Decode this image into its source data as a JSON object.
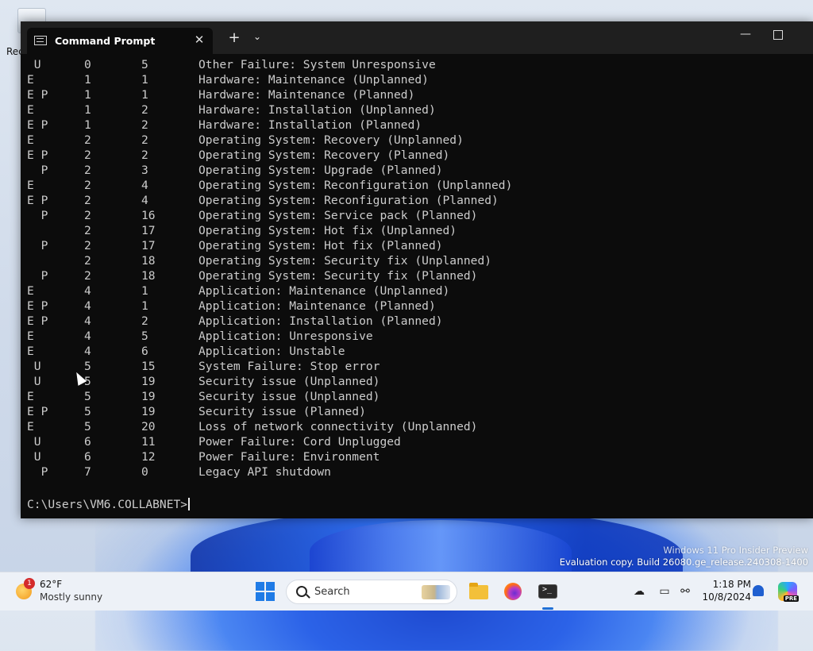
{
  "desktop": {
    "icon_label": "Rec",
    "watermark_line1": "Windows 11 Pro Insider Preview",
    "watermark_line2": "Evaluation copy. Build 26080.ge_release.240308-1400"
  },
  "window": {
    "tab_title": "Command Prompt",
    "tab_close_glyph": "✕",
    "new_tab_glyph": "+",
    "dropdown_glyph": "⌄",
    "minimize_glyph": "—"
  },
  "console": {
    "rows": [
      [
        " U",
        "0",
        "5",
        "Other Failure: System Unresponsive"
      ],
      [
        "E",
        "1",
        "1",
        "Hardware: Maintenance (Unplanned)"
      ],
      [
        "E P",
        "1",
        "1",
        "Hardware: Maintenance (Planned)"
      ],
      [
        "E",
        "1",
        "2",
        "Hardware: Installation (Unplanned)"
      ],
      [
        "E P",
        "1",
        "2",
        "Hardware: Installation (Planned)"
      ],
      [
        "E",
        "2",
        "2",
        "Operating System: Recovery (Unplanned)"
      ],
      [
        "E P",
        "2",
        "2",
        "Operating System: Recovery (Planned)"
      ],
      [
        "  P",
        "2",
        "3",
        "Operating System: Upgrade (Planned)"
      ],
      [
        "E",
        "2",
        "4",
        "Operating System: Reconfiguration (Unplanned)"
      ],
      [
        "E P",
        "2",
        "4",
        "Operating System: Reconfiguration (Planned)"
      ],
      [
        "  P",
        "2",
        "16",
        "Operating System: Service pack (Planned)"
      ],
      [
        "",
        "2",
        "17",
        "Operating System: Hot fix (Unplanned)"
      ],
      [
        "  P",
        "2",
        "17",
        "Operating System: Hot fix (Planned)"
      ],
      [
        "",
        "2",
        "18",
        "Operating System: Security fix (Unplanned)"
      ],
      [
        "  P",
        "2",
        "18",
        "Operating System: Security fix (Planned)"
      ],
      [
        "E",
        "4",
        "1",
        "Application: Maintenance (Unplanned)"
      ],
      [
        "E P",
        "4",
        "1",
        "Application: Maintenance (Planned)"
      ],
      [
        "E P",
        "4",
        "2",
        "Application: Installation (Planned)"
      ],
      [
        "E",
        "4",
        "5",
        "Application: Unresponsive"
      ],
      [
        "E",
        "4",
        "6",
        "Application: Unstable"
      ],
      [
        " U",
        "5",
        "15",
        "System Failure: Stop error"
      ],
      [
        " U",
        "5",
        "19",
        "Security issue (Unplanned)"
      ],
      [
        "E",
        "5",
        "19",
        "Security issue (Unplanned)"
      ],
      [
        "E P",
        "5",
        "19",
        "Security issue (Planned)"
      ],
      [
        "E",
        "5",
        "20",
        "Loss of network connectivity (Unplanned)"
      ],
      [
        " U",
        "6",
        "11",
        "Power Failure: Cord Unplugged"
      ],
      [
        " U",
        "6",
        "12",
        "Power Failure: Environment"
      ],
      [
        "  P",
        "7",
        "0",
        "Legacy API shutdown"
      ]
    ],
    "prompt": "C:\\Users\\VM6.COLLABNET>"
  },
  "taskbar": {
    "weather_badge": "1",
    "weather_temp": "62°F",
    "weather_desc": "Mostly sunny",
    "search_placeholder": "Search",
    "time": "1:18 PM",
    "date": "10/8/2024",
    "copilot_badge": "PRE"
  },
  "colors": {
    "console_bg": "#0c0c0c",
    "console_text": "#cccccc",
    "titlebar": "#1f1f1f",
    "accent": "#1f6fd6"
  }
}
